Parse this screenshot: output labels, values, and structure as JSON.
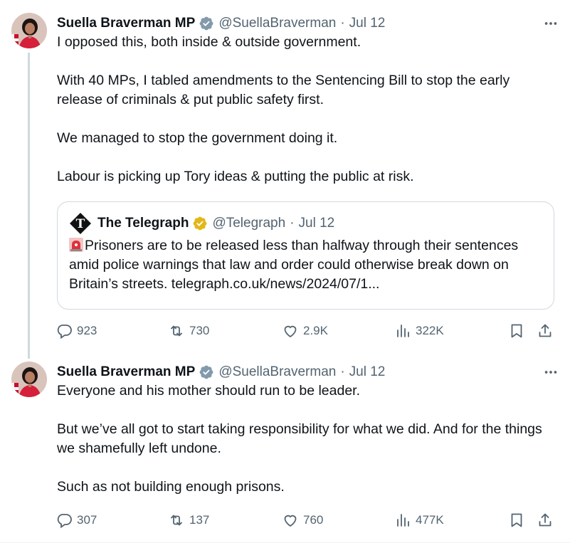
{
  "tweets": [
    {
      "author_name": "Suella Braverman MP",
      "handle": "@SuellaBraverman",
      "separator": "·",
      "date": "Jul 12",
      "paragraphs": [
        "I opposed this, both inside & outside government.",
        "With 40 MPs, I tabled amendments to the Sentencing Bill to stop the early release of criminals & put public safety first.",
        "We managed to stop the government doing it.",
        "Labour is picking up Tory ideas & putting the public at risk."
      ],
      "quote": {
        "author_name": "The Telegraph",
        "handle": "@Telegraph",
        "separator": "·",
        "date": "Jul 12",
        "emoji": "🚨",
        "text": "Prisoners are to be released less than halfway through their sentences amid police warnings that law and order could otherwise break down on Britain’s streets. telegraph.co.uk/news/2024/07/1..."
      },
      "stats": {
        "replies": "923",
        "retweets": "730",
        "likes": "2.9K",
        "views": "322K"
      }
    },
    {
      "author_name": "Suella Braverman MP",
      "handle": "@SuellaBraverman",
      "separator": "·",
      "date": "Jul 12",
      "paragraphs": [
        "Everyone and his mother should run to be leader.",
        "But we’ve all got to start taking responsibility for what we did. And for the things we shamefully left undone.",
        "Such as not building enough prisons."
      ],
      "stats": {
        "replies": "307",
        "retweets": "137",
        "likes": "760",
        "views": "477K"
      }
    }
  ],
  "icons": {
    "verified_badge": "verified-icon",
    "gold_badge": "gold-verified-icon",
    "more": "more-icon",
    "reply": "reply-icon",
    "retweet": "retweet-icon",
    "like": "heart-icon",
    "views": "views-icon",
    "bookmark": "bookmark-icon",
    "share": "share-icon"
  },
  "colors": {
    "text_primary": "#0f1419",
    "text_secondary": "#536471",
    "verified_blue": "#829aab",
    "verified_gold": "#e2b719",
    "border": "#cfd9de"
  }
}
